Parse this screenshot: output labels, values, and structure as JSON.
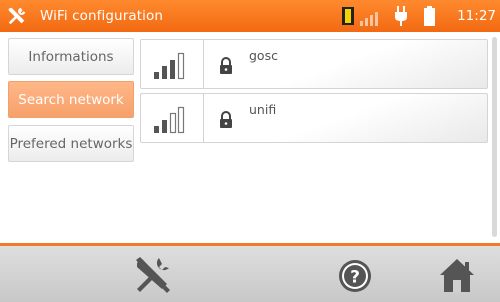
{
  "header": {
    "title": "WiFi configuration",
    "time": "11:27"
  },
  "sidebar": {
    "items": [
      {
        "label": "Informations",
        "active": false
      },
      {
        "label": "Search network",
        "active": true
      },
      {
        "label": "Prefered networks",
        "active": false
      }
    ]
  },
  "networks": [
    {
      "ssid": "gosc",
      "signal_bars": 3,
      "secured": true
    },
    {
      "ssid": "unifi",
      "signal_bars": 2,
      "secured": true
    }
  ],
  "footer": {
    "icons": [
      "tools-icon",
      "help-icon",
      "home-icon"
    ]
  },
  "colors": {
    "accent": "#f26a12",
    "active_tab": "#f7a06a",
    "icon_gray": "#666666"
  }
}
